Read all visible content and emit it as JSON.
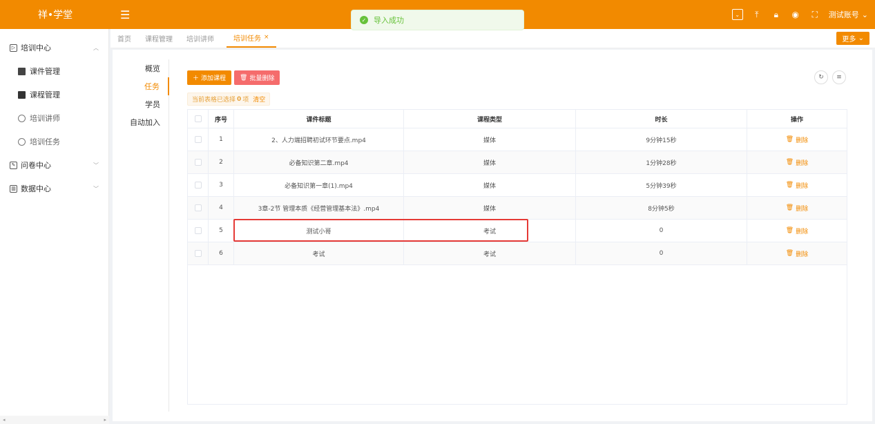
{
  "app": {
    "logo": "祥•学堂"
  },
  "toast": {
    "message": "导入成功",
    "icon": "success-check-icon",
    "color": "#67c23a"
  },
  "header": {
    "account_label": "测试账号"
  },
  "sidebar": {
    "groups": [
      {
        "label": "培训中心",
        "expanded": true,
        "items": [
          "课件管理",
          "课程管理",
          "培训讲师",
          "培训任务"
        ]
      },
      {
        "label": "问卷中心",
        "expanded": false
      },
      {
        "label": "数据中心",
        "expanded": false
      }
    ]
  },
  "tabs": [
    {
      "label": "首页",
      "active": false
    },
    {
      "label": "课程管理",
      "active": false
    },
    {
      "label": "培训讲师",
      "active": false
    },
    {
      "label": "培训任务",
      "active": true,
      "close": "×"
    }
  ],
  "more_button": "更多",
  "subnav": [
    "概览",
    "任务",
    "学员",
    "自动加入"
  ],
  "toolbar": {
    "add_label": "添加课程",
    "batch_delete_label": "批量删除"
  },
  "selection": {
    "prefix": "当前表格已选择",
    "count": "0",
    "suffix": "项",
    "clear": "清空"
  },
  "table": {
    "headers": [
      "序号",
      "课件标题",
      "课程类型",
      "时长",
      "操作"
    ],
    "rows": [
      {
        "idx": "1",
        "title": "2、人力端招聘初试环节要点.mp4",
        "type": "媒体",
        "duration": "9分钟15秒",
        "op": "删除"
      },
      {
        "idx": "2",
        "title": "必备知识第二章.mp4",
        "type": "媒体",
        "duration": "1分钟28秒",
        "op": "删除"
      },
      {
        "idx": "3",
        "title": "必备知识第一章(1).mp4",
        "type": "媒体",
        "duration": "5分钟39秒",
        "op": "删除"
      },
      {
        "idx": "4",
        "title": "3章-2节 管理本质《经营管理基本法》.mp4",
        "type": "媒体",
        "duration": "8分钟5秒",
        "op": "删除"
      },
      {
        "idx": "5",
        "title": "测试小哥",
        "type": "考试",
        "duration": "0",
        "op": "删除"
      },
      {
        "idx": "6",
        "title": "考试",
        "type": "考试",
        "duration": "0",
        "op": "删除"
      }
    ]
  },
  "colors": {
    "brand": "#f28a00",
    "danger": "#f56c6c",
    "highlight": "#e53935"
  }
}
